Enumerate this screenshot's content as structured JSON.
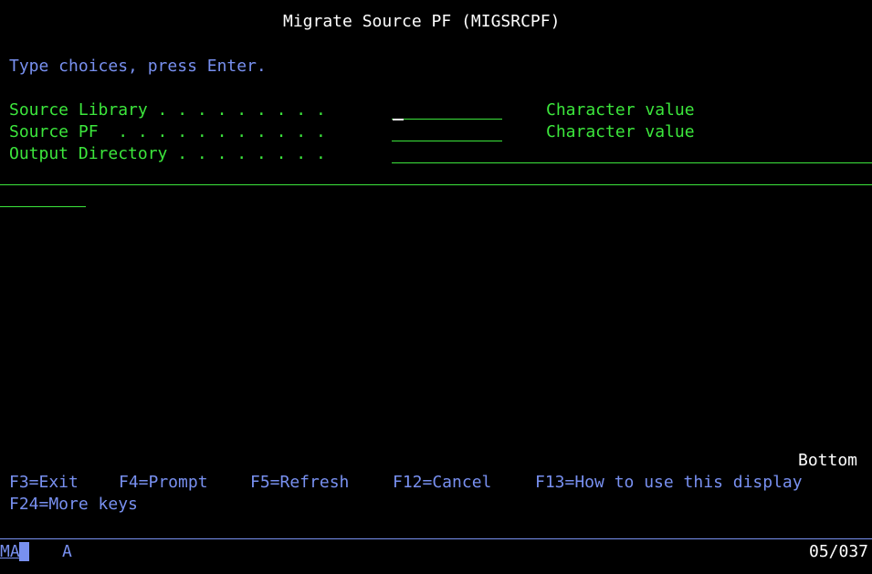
{
  "screen": {
    "title": "Migrate Source PF (MIGSRCPF)",
    "instructions": "Type choices, press Enter."
  },
  "fields": [
    {
      "label": "Source Library . . . . . . . . .",
      "value": "",
      "hint": "Character value"
    },
    {
      "label": "Source PF  . . . . . . . . . . .",
      "value": "",
      "hint": "Character value"
    },
    {
      "label": "Output Directory . . . . . . . .",
      "value": "",
      "hint": ""
    }
  ],
  "list_position": "Bottom",
  "function_keys": {
    "f3": "F3=Exit",
    "f4": "F4=Prompt",
    "f5": "F5=Refresh",
    "f12": "F12=Cancel",
    "f13": "F13=How to use this display",
    "f24": "F24=More keys"
  },
  "status_bar": {
    "session": "MA",
    "mode": "A",
    "cursor_position": "05/037"
  },
  "colors": {
    "background": "#000000",
    "title": "#ffffff",
    "info": "#7890f0",
    "field": "#3ce63c"
  }
}
